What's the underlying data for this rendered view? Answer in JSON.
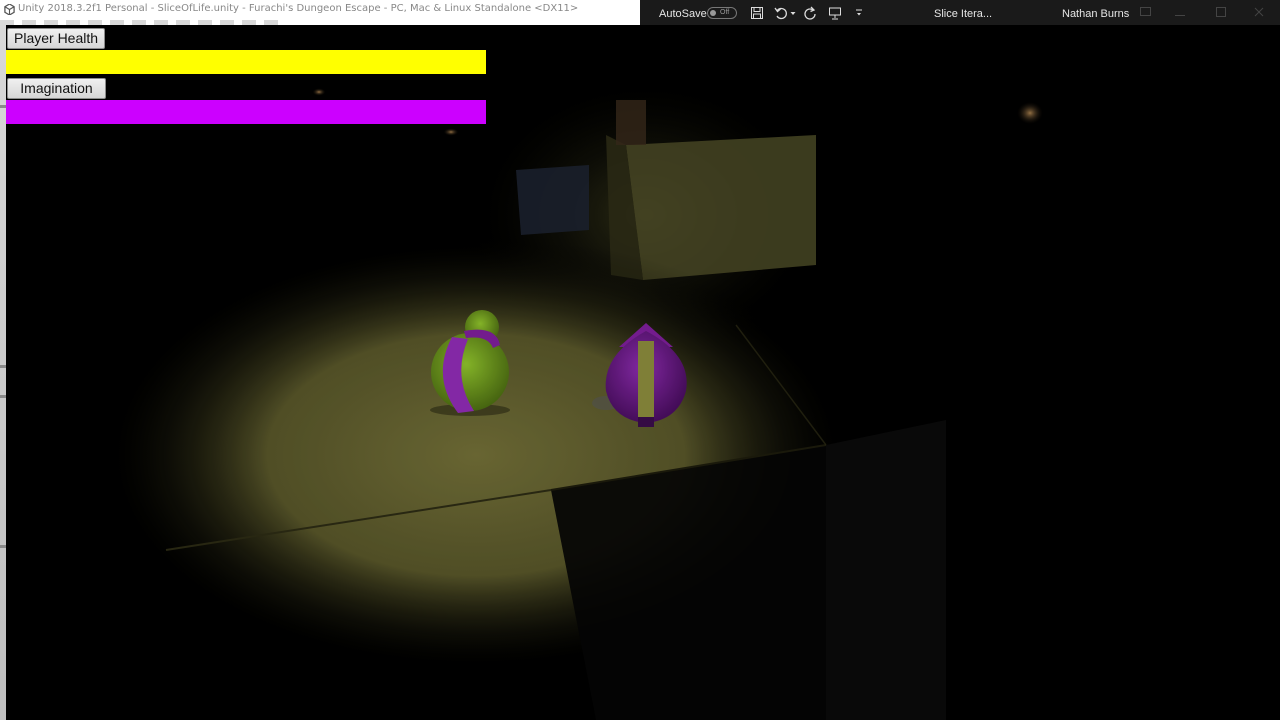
{
  "unity_window": {
    "title": "Unity 2018.3.2f1 Personal - SliceOfLife.unity - Furachi's Dungeon Escape - PC, Mac & Linux Standalone <DX11>"
  },
  "office_bar": {
    "autosave_label": "AutoSave",
    "autosave_state": "Off",
    "document_title": "Slice Itera...",
    "user_name": "Nathan Burns"
  },
  "hud": {
    "health": {
      "label": "Player Health",
      "color": "#ffff00",
      "level": 1.0
    },
    "imagination": {
      "label": "Imagination",
      "color": "#cc00ff",
      "level": 1.0
    }
  },
  "scene": {
    "spotlight_color": "#6d6a34",
    "character_green": "#7aa825",
    "character_purple": "#7d1f99"
  }
}
